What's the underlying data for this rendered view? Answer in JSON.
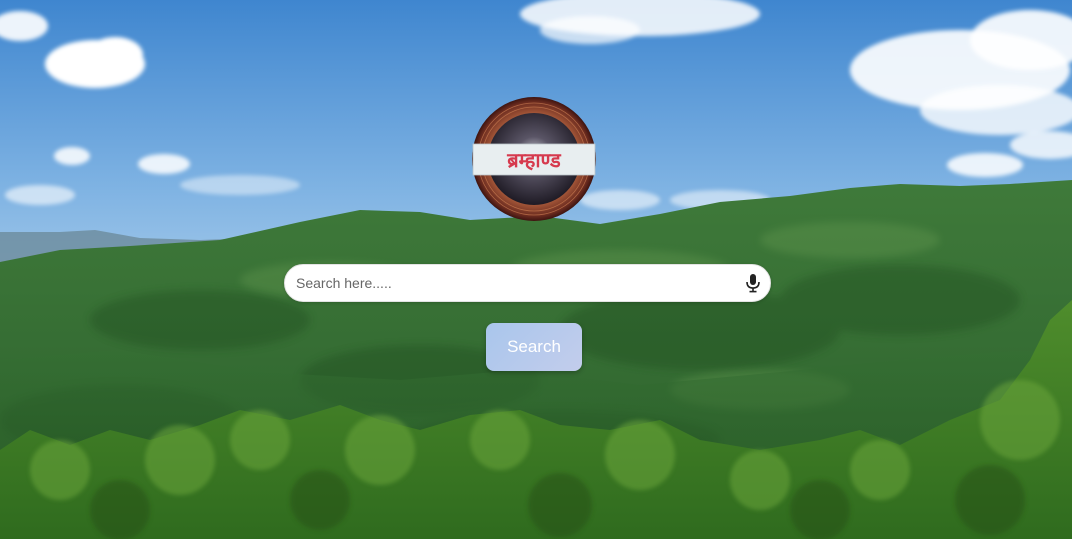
{
  "logo": {
    "text": "ब्रम्हाण्ड"
  },
  "search": {
    "placeholder": "Search here.....",
    "value": "",
    "button_label": "Search"
  },
  "icons": {
    "voice": "microphone-icon"
  },
  "colors": {
    "button_gradient_start": "#a9c6ec",
    "button_gradient_end": "#c3cdec",
    "logo_text": "#d63a4e",
    "logo_band": "#e8eef0",
    "logo_ring": "#8a3b2c"
  }
}
